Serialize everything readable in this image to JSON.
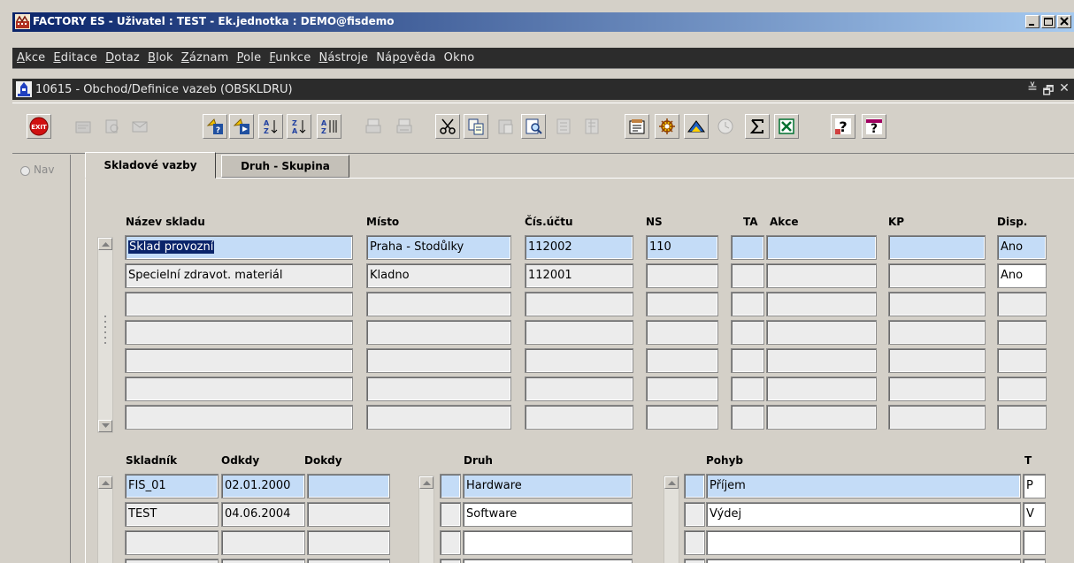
{
  "window": {
    "title": "FACTORY ES - Uživatel : TEST - Ek.jednotka : DEMO@fisdemo",
    "controls": [
      "minimize-icon",
      "maximize-icon",
      "close-icon"
    ]
  },
  "menu": [
    {
      "pre": "",
      "u": "A",
      "post": "kce"
    },
    {
      "pre": "",
      "u": "E",
      "post": "ditace"
    },
    {
      "pre": "",
      "u": "D",
      "post": "otaz"
    },
    {
      "pre": "",
      "u": "B",
      "post": "lok"
    },
    {
      "pre": "",
      "u": "Z",
      "post": "áznam"
    },
    {
      "pre": "",
      "u": "P",
      "post": "ole"
    },
    {
      "pre": "",
      "u": "F",
      "post": "unkce"
    },
    {
      "pre": "",
      "u": "N",
      "post": "ástroje"
    },
    {
      "pre": "Náp",
      "u": "o",
      "post": "věda"
    },
    {
      "pre": "Okno",
      "u": "",
      "post": ""
    }
  ],
  "form": {
    "title": "10615 - Obchod/Definice vazeb (OBSKLDRU)",
    "controls": [
      "≚",
      "🗗",
      "✕"
    ]
  },
  "toolbar": [
    {
      "name": "exit-icon",
      "enabled": true
    },
    {
      "name": "save-icon",
      "enabled": false
    },
    {
      "name": "print-preview-icon",
      "enabled": false
    },
    {
      "name": "mail-icon",
      "enabled": false
    },
    {
      "name": "query-enter-icon",
      "enabled": true
    },
    {
      "name": "query-execute-icon",
      "enabled": true
    },
    {
      "name": "sort-ascending-icon",
      "enabled": true
    },
    {
      "name": "sort-descending-icon",
      "enabled": true
    },
    {
      "name": "sort-multi-icon",
      "enabled": true
    },
    {
      "name": "print-icon",
      "enabled": false
    },
    {
      "name": "print-setup-icon",
      "enabled": false
    },
    {
      "name": "cut-icon",
      "enabled": true
    },
    {
      "name": "copy-icon",
      "enabled": true
    },
    {
      "name": "paste-icon",
      "enabled": false
    },
    {
      "name": "find-icon",
      "enabled": true
    },
    {
      "name": "insert-record-icon",
      "enabled": false
    },
    {
      "name": "delete-record-icon",
      "enabled": false
    },
    {
      "name": "edit-icon",
      "enabled": true
    },
    {
      "name": "settings-icon",
      "enabled": true
    },
    {
      "name": "chart-icon",
      "enabled": true
    },
    {
      "name": "clock-icon",
      "enabled": false
    },
    {
      "name": "sum-icon",
      "enabled": true
    },
    {
      "name": "excel-icon",
      "enabled": true
    },
    {
      "name": "help-icon",
      "enabled": true
    },
    {
      "name": "context-help-icon",
      "enabled": true
    }
  ],
  "nav": {
    "label": "Nav"
  },
  "tabs": [
    {
      "label": "Skladové vazby",
      "active": true
    },
    {
      "label": "Druh - Skupina",
      "active": false
    }
  ],
  "warehouses": {
    "headers": {
      "name": "Název skladu",
      "place": "Místo",
      "account": "Čís.účtu",
      "ns": "NS",
      "ta": "TA",
      "action": "Akce",
      "kp": "KP",
      "disp": "Disp."
    },
    "rows": [
      {
        "name": "Sklad provozní",
        "place": "Praha - Stodůlky",
        "account": "112002",
        "ns": "110",
        "ta": "",
        "action": "",
        "kp": "",
        "disp": "Ano"
      },
      {
        "name": "Specielní zdravot. materiál",
        "place": "Kladno",
        "account": "112001",
        "ns": "",
        "ta": "",
        "action": "",
        "kp": "",
        "disp": "Ano"
      },
      {
        "name": "",
        "place": "",
        "account": "",
        "ns": "",
        "ta": "",
        "action": "",
        "kp": "",
        "disp": ""
      },
      {
        "name": "",
        "place": "",
        "account": "",
        "ns": "",
        "ta": "",
        "action": "",
        "kp": "",
        "disp": ""
      },
      {
        "name": "",
        "place": "",
        "account": "",
        "ns": "",
        "ta": "",
        "action": "",
        "kp": "",
        "disp": ""
      },
      {
        "name": "",
        "place": "",
        "account": "",
        "ns": "",
        "ta": "",
        "action": "",
        "kp": "",
        "disp": ""
      },
      {
        "name": "",
        "place": "",
        "account": "",
        "ns": "",
        "ta": "",
        "action": "",
        "kp": "",
        "disp": ""
      }
    ]
  },
  "keepers": {
    "headers": {
      "keeper": "Skladník",
      "from": "Odkdy",
      "to": "Dokdy"
    },
    "rows": [
      {
        "keeper": "FIS_01",
        "from": "02.01.2000",
        "to": ""
      },
      {
        "keeper": "TEST",
        "from": "04.06.2004",
        "to": ""
      },
      {
        "keeper": "",
        "from": "",
        "to": ""
      },
      {
        "keeper": "",
        "from": "",
        "to": ""
      }
    ]
  },
  "kinds": {
    "headers": {
      "kind": "Druh"
    },
    "rows": [
      {
        "kind": "Hardware"
      },
      {
        "kind": "Software"
      },
      {
        "kind": ""
      },
      {
        "kind": ""
      }
    ]
  },
  "movements": {
    "headers": {
      "movement": "Pohyb",
      "t": "T"
    },
    "rows": [
      {
        "movement": "Příjem",
        "t": "P"
      },
      {
        "movement": "Výdej",
        "t": "V"
      },
      {
        "movement": "",
        "t": ""
      },
      {
        "movement": "",
        "t": ""
      }
    ]
  },
  "colors": {
    "current_record": "#c4dcf7",
    "selection": "#0a246a",
    "canvas": "#d4d0c8"
  }
}
